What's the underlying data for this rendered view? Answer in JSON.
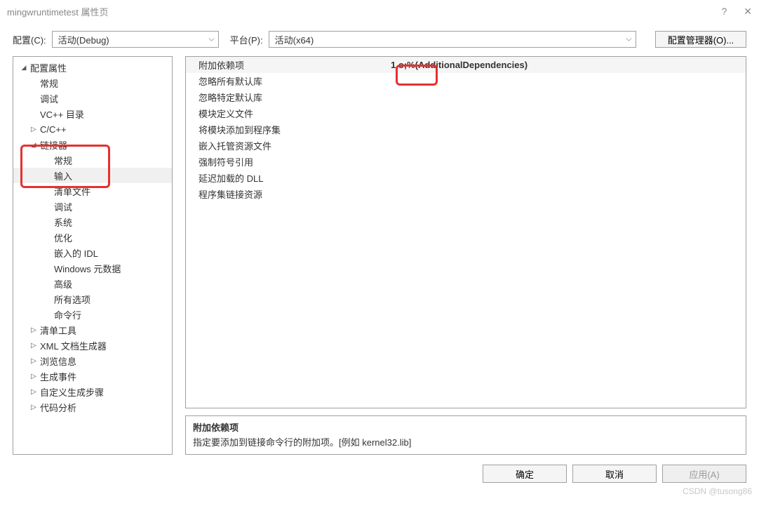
{
  "title": "mingwruntimetest 属性页",
  "labels": {
    "config": "配置(C):",
    "platform": "平台(P):",
    "config_mgr": "配置管理器(O)..."
  },
  "selects": {
    "config_value": "活动(Debug)",
    "platform_value": "活动(x64)"
  },
  "tree": {
    "root": "配置属性",
    "general": "常规",
    "debug": "调试",
    "vcdir": "VC++ 目录",
    "ccpp": "C/C++",
    "linker": "链接器",
    "l_general": "常规",
    "l_input": "输入",
    "l_manifest": "清单文件",
    "l_debug": "调试",
    "l_system": "系统",
    "l_optimize": "优化",
    "l_idl": "嵌入的 IDL",
    "l_winmd": "Windows 元数据",
    "l_advanced": "高级",
    "l_allopts": "所有选项",
    "l_cmdline": "命令行",
    "manifest_tool": "清单工具",
    "xml_gen": "XML 文档生成器",
    "browse": "浏览信息",
    "build_events": "生成事件",
    "custom_build": "自定义生成步骤",
    "code_analysis": "代码分析"
  },
  "props": {
    "p0": {
      "name": "附加依赖项",
      "value": "1.o;%(AdditionalDependencies)"
    },
    "p1": {
      "name": "忽略所有默认库",
      "value": ""
    },
    "p2": {
      "name": "忽略特定默认库",
      "value": ""
    },
    "p3": {
      "name": "模块定义文件",
      "value": ""
    },
    "p4": {
      "name": "将模块添加到程序集",
      "value": ""
    },
    "p5": {
      "name": "嵌入托管资源文件",
      "value": ""
    },
    "p6": {
      "name": "强制符号引用",
      "value": ""
    },
    "p7": {
      "name": "延迟加载的 DLL",
      "value": ""
    },
    "p8": {
      "name": "程序集链接资源",
      "value": ""
    }
  },
  "desc": {
    "title": "附加依赖项",
    "text": "指定要添加到链接命令行的附加项。[例如 kernel32.lib]"
  },
  "buttons": {
    "ok": "确定",
    "cancel": "取消",
    "apply": "应用(A)"
  },
  "watermark": "CSDN @tusong86"
}
